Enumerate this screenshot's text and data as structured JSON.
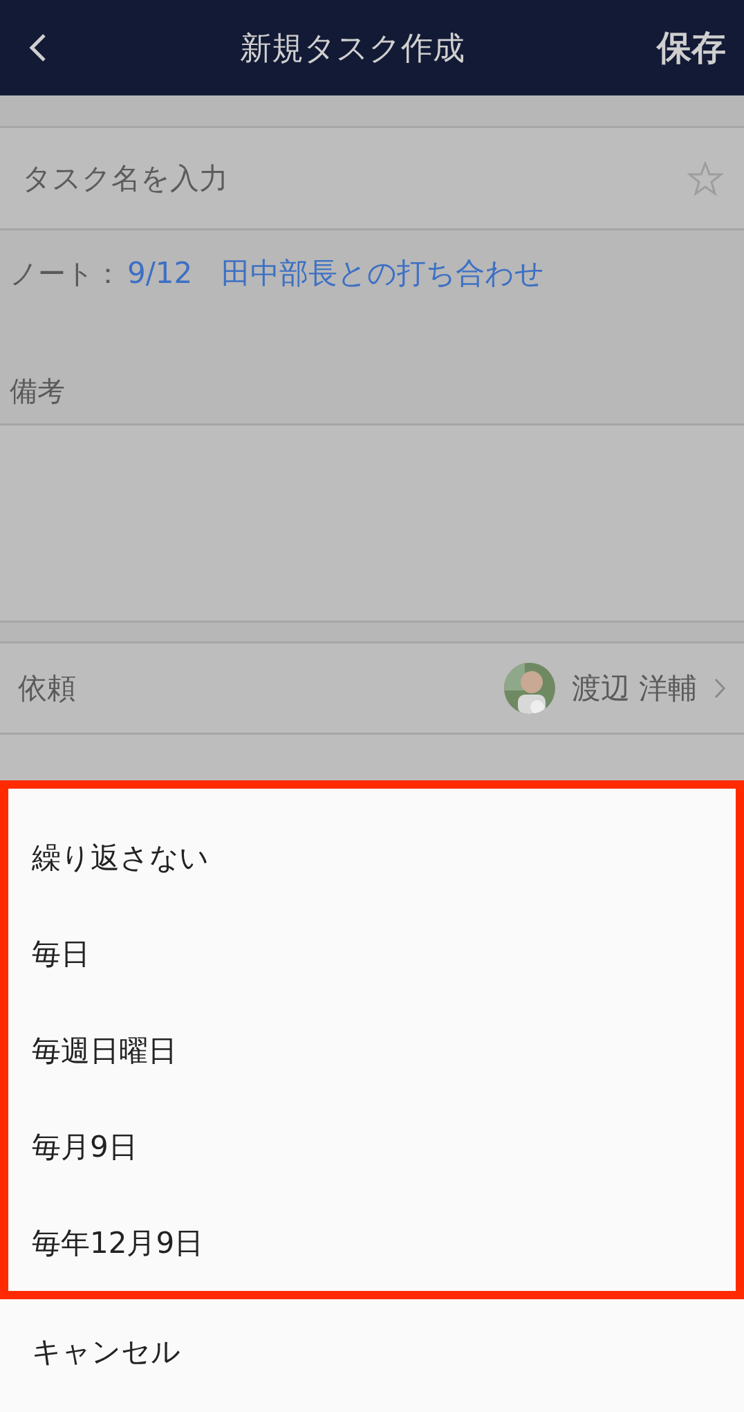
{
  "header": {
    "title": "新規タスク作成",
    "save": "保存"
  },
  "task_name": {
    "placeholder": "タスク名を入力",
    "starred": false
  },
  "note": {
    "label": "ノート：",
    "link": "9/12　田中部長との打ち合わせ"
  },
  "remarks": {
    "label": "備考"
  },
  "fields": [
    {
      "label": "依頼",
      "value": "渡辺 洋輔"
    }
  ],
  "repeat_sheet": {
    "options": [
      "繰り返さない",
      "毎日",
      "毎週日曜日",
      "毎月9日",
      "毎年12月9日"
    ],
    "cancel": "キャンセル"
  }
}
